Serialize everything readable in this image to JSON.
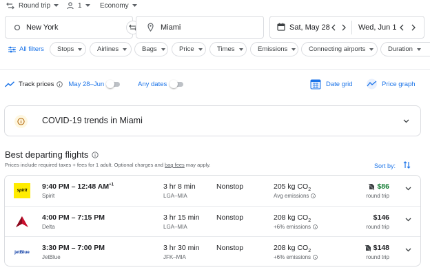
{
  "search_options": {
    "trip_type": "Round trip",
    "passengers": "1",
    "cabin_class": "Economy"
  },
  "search": {
    "origin": "New York",
    "destination": "Miami",
    "depart_date": "Sat, May 28",
    "return_date": "Wed, Jun 1"
  },
  "filters": {
    "all_filters": "All filters",
    "chips": [
      "Stops",
      "Airlines",
      "Bags",
      "Price",
      "Times",
      "Emissions",
      "Connecting airports",
      "Duration"
    ]
  },
  "tracking": {
    "label": "Track prices",
    "date_range": "May 28–Jun 1",
    "any_dates": "Any dates",
    "date_grid": "Date grid",
    "price_graph": "Price graph"
  },
  "covid": {
    "title": "COVID-19 trends in Miami"
  },
  "results": {
    "heading": "Best departing flights",
    "note_prefix": "Prices include required taxes + fees for 1 adult. Optional charges and ",
    "note_link": "bag fees",
    "note_suffix": " may apply.",
    "sort_label": "Sort by:",
    "flights": [
      {
        "airline_logo_text": "spirit",
        "times": "9:40 PM – 12:48 AM",
        "day_offset": "+1",
        "airline": "Spirit",
        "duration": "3 hr 8 min",
        "route": "LGA–MIA",
        "stops": "Nonstop",
        "co2": "205 kg CO",
        "co2_sub": "2",
        "emissions_note": "Avg emissions",
        "price": "$86",
        "price_type": "round trip",
        "price_color": "#188038"
      },
      {
        "airline_logo_text": "",
        "times": "4:00 PM – 7:15 PM",
        "day_offset": "",
        "airline": "Delta",
        "duration": "3 hr 15 min",
        "route": "LGA–MIA",
        "stops": "Nonstop",
        "co2": "208 kg CO",
        "co2_sub": "2",
        "emissions_note": "+6% emissions",
        "price": "$146",
        "price_type": "round trip",
        "price_color": "#202124"
      },
      {
        "airline_logo_text": "jetBlue",
        "times": "3:30 PM – 7:00 PM",
        "day_offset": "",
        "airline": "JetBlue",
        "duration": "3 hr 30 min",
        "route": "JFK–MIA",
        "stops": "Nonstop",
        "co2": "208 kg CO",
        "co2_sub": "2",
        "emissions_note": "+6% emissions",
        "price": "$148",
        "price_type": "round trip",
        "price_color": "#202124"
      }
    ]
  },
  "colors": {
    "accent": "#1a73e8",
    "deal_green": "#188038",
    "spirit_yellow": "#ffec00",
    "delta_red": "#c8102e",
    "jetblue_blue": "#0033a0"
  }
}
